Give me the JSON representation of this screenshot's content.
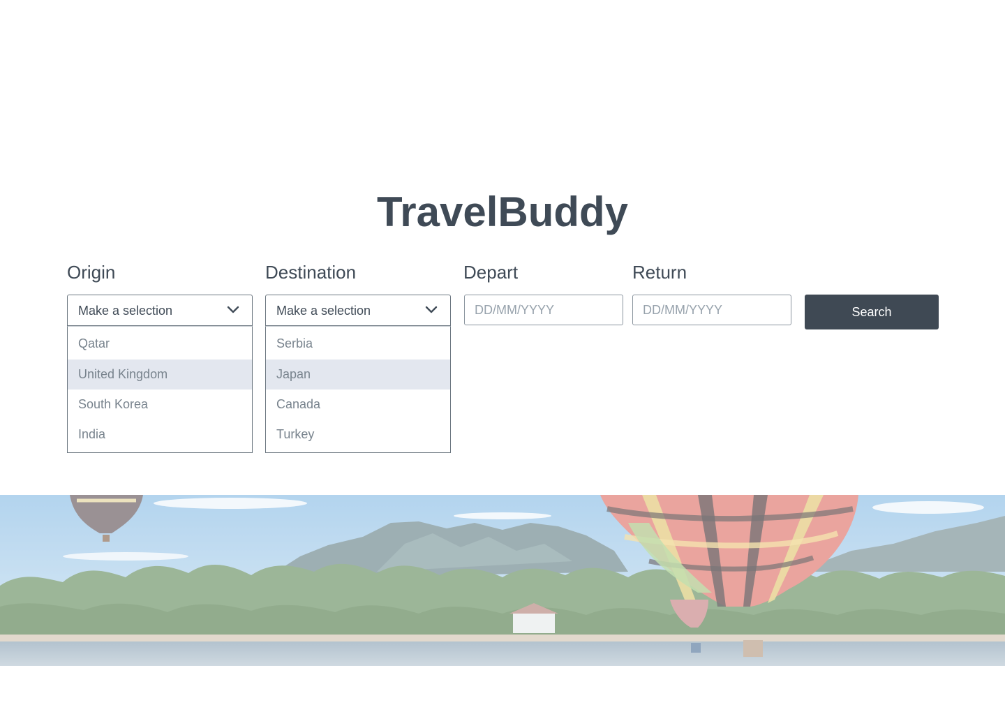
{
  "app": {
    "title": "TravelBuddy"
  },
  "search_form": {
    "origin": {
      "label": "Origin",
      "selected": "Make a selection",
      "options": [
        "Qatar",
        "United Kingdom",
        "South Korea",
        "India"
      ],
      "highlighted_option": "United Kingdom"
    },
    "destination": {
      "label": "Destination",
      "selected": "Make a selection",
      "options": [
        "Serbia",
        "Japan",
        "Canada",
        "Turkey"
      ],
      "highlighted_option": "Japan"
    },
    "depart": {
      "label": "Depart",
      "placeholder": "DD/MM/YYYY"
    },
    "return": {
      "label": "Return",
      "placeholder": "DD/MM/YYYY"
    },
    "search_label": "Search"
  },
  "icons": {
    "dropdown": "chevron-down-icon"
  },
  "colors": {
    "primary_text": "#3f4a56",
    "button_bg": "#3f4954",
    "option_highlight": "#e3e7ef",
    "option_text": "#78838d"
  }
}
